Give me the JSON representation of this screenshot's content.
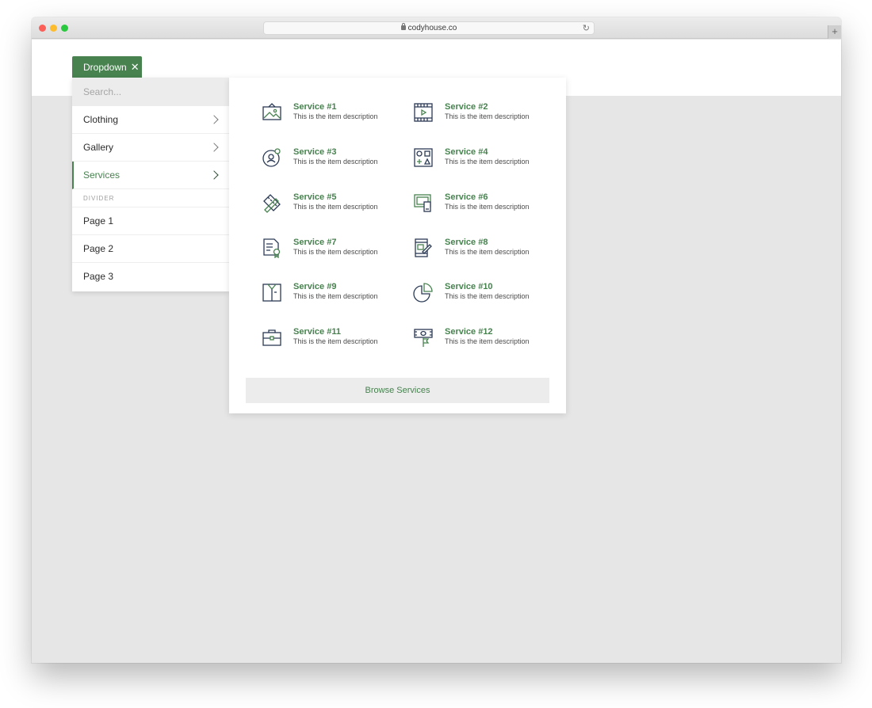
{
  "browser": {
    "url": "codyhouse.co",
    "newtab_symbol": "+"
  },
  "dropdown": {
    "label": "Dropdown",
    "close_symbol": "✕"
  },
  "menu": {
    "search_placeholder": "Search...",
    "items": [
      {
        "label": "Clothing"
      },
      {
        "label": "Gallery"
      },
      {
        "label": "Services"
      }
    ],
    "divider_label": "DIVIDER",
    "pages": [
      {
        "label": "Page 1"
      },
      {
        "label": "Page 2"
      },
      {
        "label": "Page 3"
      }
    ]
  },
  "services": [
    {
      "title": "Service #1",
      "desc": "This is the item description",
      "icon": "picture-icon"
    },
    {
      "title": "Service #2",
      "desc": "This is the item description",
      "icon": "video-film-icon"
    },
    {
      "title": "Service #3",
      "desc": "This is the item description",
      "icon": "user-profile-icon"
    },
    {
      "title": "Service #4",
      "desc": "This is the item description",
      "icon": "shapes-icon"
    },
    {
      "title": "Service #5",
      "desc": "This is the item description",
      "icon": "ruler-pencil-icon"
    },
    {
      "title": "Service #6",
      "desc": "This is the item description",
      "icon": "devices-icon"
    },
    {
      "title": "Service #7",
      "desc": "This is the item description",
      "icon": "certificate-icon"
    },
    {
      "title": "Service #8",
      "desc": "This is the item description",
      "icon": "mobile-edit-icon"
    },
    {
      "title": "Service #9",
      "desc": "This is the item description",
      "icon": "shirt-box-icon"
    },
    {
      "title": "Service #10",
      "desc": "This is the item description",
      "icon": "pie-chart-icon"
    },
    {
      "title": "Service #11",
      "desc": "This is the item description",
      "icon": "briefcase-icon"
    },
    {
      "title": "Service #12",
      "desc": "This is the item description",
      "icon": "money-flag-icon"
    }
  ],
  "browse_label": "Browse Services",
  "colors": {
    "accent": "#47824f",
    "icon_dark": "#2b3a55"
  }
}
